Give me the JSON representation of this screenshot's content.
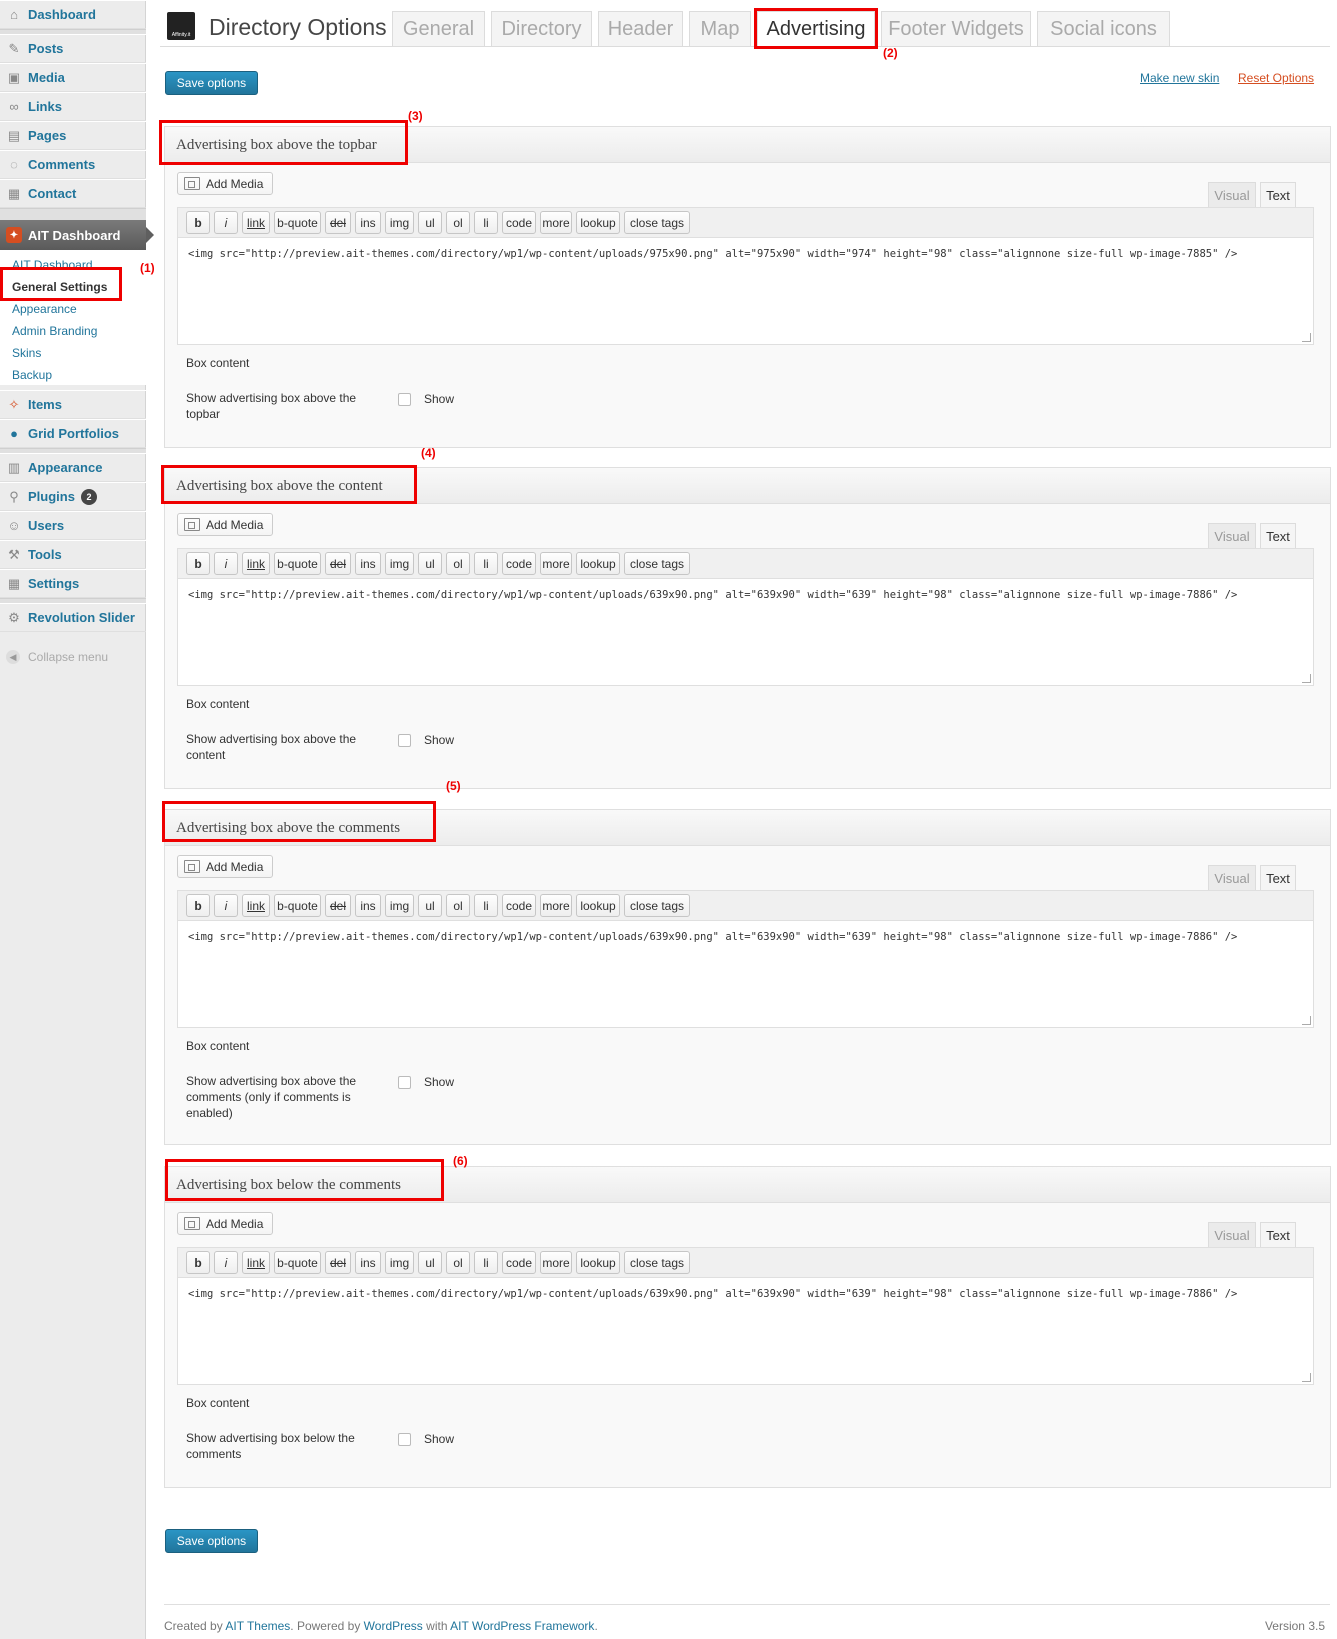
{
  "sidebar": {
    "top_items": [
      {
        "label": "Dashboard",
        "icon": "dashboard-icon"
      },
      {
        "label": "Posts",
        "icon": "pin-icon"
      },
      {
        "label": "Media",
        "icon": "media-icon"
      },
      {
        "label": "Links",
        "icon": "link-icon"
      },
      {
        "label": "Pages",
        "icon": "pages-icon"
      },
      {
        "label": "Comments",
        "icon": "comment-icon"
      },
      {
        "label": "Contact",
        "icon": "contact-icon"
      }
    ],
    "current": {
      "label": "AIT Dashboard",
      "icon": "ait-logo-icon"
    },
    "submenu": [
      "AIT Dashboard",
      "General Settings",
      "Appearance",
      "Admin Branding",
      "Skins",
      "Backup"
    ],
    "mid_items": [
      {
        "label": "Items",
        "icon": "items-icon"
      },
      {
        "label": "Grid Portfolios",
        "icon": "portfolio-icon"
      }
    ],
    "admin_items": [
      {
        "label": "Appearance",
        "icon": "appearance-icon"
      },
      {
        "label": "Plugins",
        "icon": "plugin-icon",
        "badge": "2"
      },
      {
        "label": "Users",
        "icon": "users-icon"
      },
      {
        "label": "Tools",
        "icon": "tools-icon"
      },
      {
        "label": "Settings",
        "icon": "settings-icon"
      }
    ],
    "slider_item": {
      "label": "Revolution Slider",
      "icon": "slider-icon"
    },
    "collapse_label": "Collapse menu"
  },
  "header": {
    "logo_text": "Affinity.it",
    "title": "Directory Options",
    "tabs": [
      "General",
      "Directory",
      "Header",
      "Map",
      "Advertising",
      "Footer Widgets",
      "Social icons"
    ],
    "active_tab": "Advertising"
  },
  "actions": {
    "save_label": "Save options",
    "make_skin": "Make new skin",
    "reset": "Reset Options",
    "link_color": "#21759b",
    "reset_color": "#d54e21"
  },
  "editor": {
    "add_media": "Add Media",
    "tab_visual": "Visual",
    "tab_text": "Text",
    "buttons": [
      "b",
      "i",
      "link",
      "b-quote",
      "del",
      "ins",
      "img",
      "ul",
      "ol",
      "li",
      "code",
      "more",
      "lookup",
      "close tags"
    ],
    "box_content_label": "Box content",
    "show_label": "Show"
  },
  "sections": [
    {
      "title": "Advertising box above the topbar",
      "code": "<img src=\"http://preview.ait-themes.com/directory/wp1/wp-content/uploads/975x90.png\" alt=\"975x90\" width=\"974\" height=\"98\" class=\"alignnone size-full wp-image-7885\" />",
      "show_text": "Show advertising box above the topbar",
      "checked": false
    },
    {
      "title": "Advertising box above the content",
      "code": "<img src=\"http://preview.ait-themes.com/directory/wp1/wp-content/uploads/639x90.png\" alt=\"639x90\" width=\"639\" height=\"98\" class=\"alignnone size-full wp-image-7886\" />",
      "show_text": "Show advertising box above the content",
      "checked": false
    },
    {
      "title": "Advertising box above the comments",
      "code": "<img src=\"http://preview.ait-themes.com/directory/wp1/wp-content/uploads/639x90.png\" alt=\"639x90\" width=\"639\" height=\"98\" class=\"alignnone size-full wp-image-7886\" />",
      "show_text": "Show advertising box above the comments (only if comments is enabled)",
      "checked": false
    },
    {
      "title": "Advertising box below the comments",
      "code": "<img src=\"http://preview.ait-themes.com/directory/wp1/wp-content/uploads/639x90.png\" alt=\"639x90\" width=\"639\" height=\"98\" class=\"alignnone size-full wp-image-7886\" />",
      "show_text": "Show advertising box below the comments",
      "checked": false
    }
  ],
  "annotations": [
    "(1)",
    "(2)",
    "(3)",
    "(4)",
    "(5)",
    "(6)"
  ],
  "annotation_color": "#ee0000",
  "footer": {
    "created_by": "Created by ",
    "ait_themes": "AIT Themes",
    "powered_by": ". Powered by ",
    "wordpress": "WordPress",
    "with": " with ",
    "framework": "AIT WordPress Framework",
    "period": ".",
    "version": "Version 3.5"
  }
}
